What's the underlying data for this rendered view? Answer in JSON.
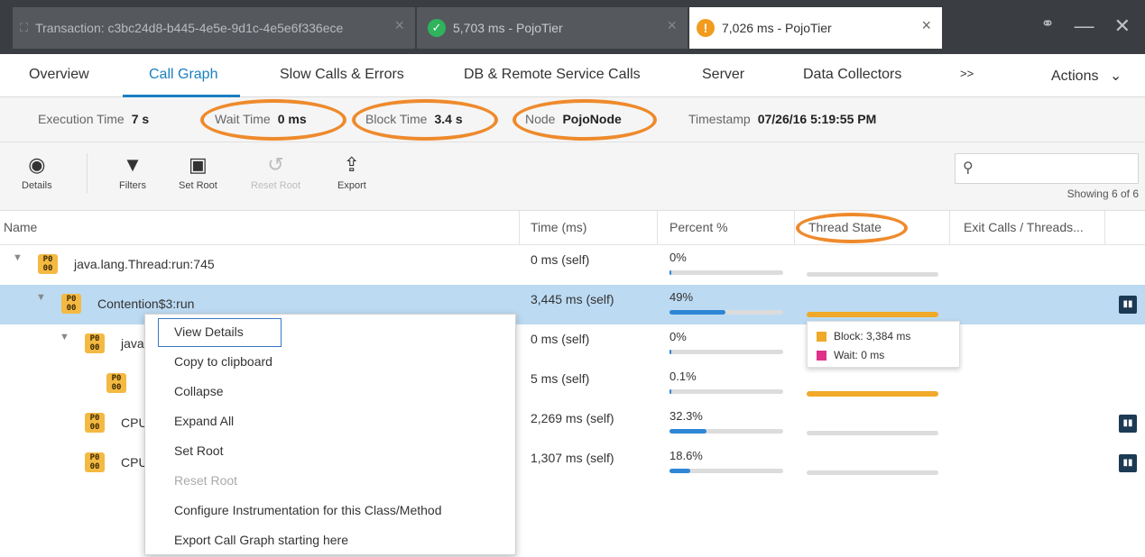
{
  "tabs": [
    {
      "label": "Transaction: c3bc24d8-b445-4e5e-9d1c-4e5e6f336ece",
      "icon": "transaction-icon"
    },
    {
      "label": "5,703 ms - PojoTier",
      "icon": "check-circle-icon",
      "status_color": "#2fb35c"
    },
    {
      "label": "7,026 ms - PojoTier",
      "icon": "warning-circle-icon",
      "status_color": "#f29b1e"
    }
  ],
  "tab_close": "×",
  "window_controls": {
    "link": "🔗",
    "minimize": "—",
    "close": "✕"
  },
  "nav": {
    "items": [
      "Overview",
      "Call Graph",
      "Slow Calls & Errors",
      "DB & Remote Service Calls",
      "Server",
      "Data Collectors",
      ">>",
      "Actions"
    ],
    "active": "Call Graph",
    "actions_chevron": "⌄"
  },
  "info": {
    "execution_time_label": "Execution Time",
    "execution_time": "7 s",
    "wait_time_label": "Wait Time",
    "wait_time": "0 ms",
    "block_time_label": "Block Time",
    "block_time": "3.4 s",
    "node_label": "Node",
    "node": "PojoNode",
    "timestamp_label": "Timestamp",
    "timestamp": "07/26/16 5:19:55 PM"
  },
  "toolbar": {
    "details": "Details",
    "filters": "Filters",
    "set_root": "Set Root",
    "reset_root": "Reset Root",
    "export": "Export",
    "search_placeholder": "",
    "showing": "Showing 6 of 6"
  },
  "columns": {
    "name": "Name",
    "time": "Time (ms)",
    "percent": "Percent %",
    "thread_state": "Thread State",
    "exit_calls": "Exit Calls / Threads..."
  },
  "rows": [
    {
      "name": "java.lang.Thread:run:745",
      "time": "0 ms (self)",
      "percent": "0%",
      "percent_value": 0,
      "thread_state": "none"
    },
    {
      "name": "Contention$3:run",
      "time": "3,445 ms (self)",
      "percent": "49%",
      "percent_value": 49,
      "thread_state": "block"
    },
    {
      "name": "java",
      "time": "0 ms (self)",
      "percent": "0%",
      "percent_value": 0,
      "thread_state": "none"
    },
    {
      "name": "",
      "time": "5 ms (self)",
      "percent": "0.1%",
      "percent_value": 0.1,
      "thread_state": "block"
    },
    {
      "name": "CPU",
      "time": "2,269 ms (self)",
      "percent": "32.3%",
      "percent_value": 32.3,
      "thread_state": "none"
    },
    {
      "name": "CPU",
      "time": "1,307 ms (self)",
      "percent": "18.6%",
      "percent_value": 18.6,
      "thread_state": "none"
    }
  ],
  "tooltip": {
    "block": "Block: 3,384 ms",
    "block_color": "#f0a928",
    "wait": "Wait: 0 ms",
    "wait_color": "#e0308a"
  },
  "context_menu": {
    "items": [
      "View Details",
      "Copy to clipboard",
      "Collapse",
      "Expand All",
      "Set Root",
      "Reset Root",
      "Configure Instrumentation for this Class/Method",
      "Export Call Graph starting here"
    ],
    "disabled": [
      "Reset Root"
    ],
    "focused": "View Details"
  },
  "colors": {
    "accent": "#1a7fc1",
    "highlight_ring": "#ee8a2c",
    "selected_row": "#bcdaf2",
    "node_icon": "#f4b942",
    "bar": "#2d86d6"
  }
}
